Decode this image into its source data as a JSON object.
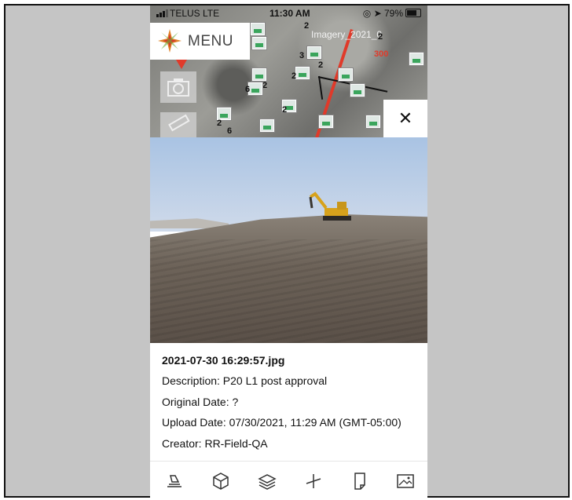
{
  "status": {
    "carrier": "TELUS  LTE",
    "time": "11:30 AM",
    "battery": "79%"
  },
  "map": {
    "menu_label": "MENU",
    "imagery_label": "Imagery_2021_0",
    "label_300": "300",
    "cluster_counts": [
      "2",
      "2",
      "3",
      "2",
      "2",
      "2",
      "6",
      "2",
      "2",
      "2",
      "6"
    ],
    "route_color": "#e03a2a"
  },
  "close_symbol": "✕",
  "photo_info": {
    "filename": "2021-07-30 16:29:57.jpg",
    "description": "Description: P20 L1 post approval",
    "original_date": "Original Date: ?",
    "upload_date": "Upload Date: 07/30/2021, 11:29 AM (GMT-05:00)",
    "creator": "Creator: RR-Field-QA"
  },
  "toolbar": {
    "icons": [
      "survey-icon",
      "cube-icon",
      "layers-icon",
      "axis-icon",
      "document-icon",
      "image-icon"
    ]
  }
}
